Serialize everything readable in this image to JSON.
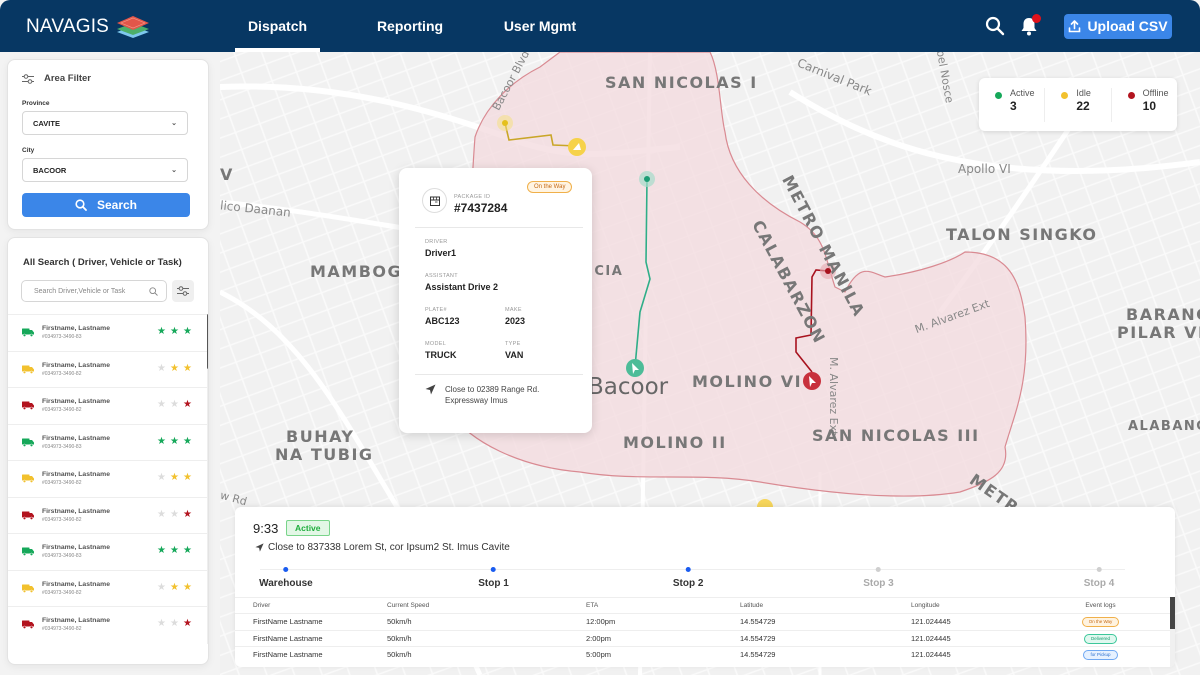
{
  "header": {
    "logo_text": "NAVAGIS",
    "tabs": [
      {
        "label": "Dispatch",
        "active": true
      },
      {
        "label": "Reporting",
        "active": false
      },
      {
        "label": "User Mgmt",
        "active": false
      }
    ],
    "upload_label": "Upload CSV",
    "icons": {
      "search": "search-icon",
      "bell": "bell-icon",
      "upload": "upload-icon"
    },
    "notification_dot": true
  },
  "area_filter": {
    "title": "Area Filter",
    "province_label": "Province",
    "province_value": "CAVITE",
    "city_label": "City",
    "city_value": "BACOOR",
    "search_label": "Search"
  },
  "all_search": {
    "title": "All Search ( Driver, Vehicle or Task)",
    "placeholder": "Search Driver,Vehicle or Task",
    "items": [
      {
        "name": "Firstname, Lastname",
        "id": "#034973-3490-83",
        "status": "active",
        "rating": 3
      },
      {
        "name": "Firstname, Lastname",
        "id": "#034973-3490-82",
        "status": "idle",
        "rating": 2
      },
      {
        "name": "Firstname, Lastname",
        "id": "#034973-3490-82",
        "status": "offline",
        "rating": 1
      },
      {
        "name": "Firstname, Lastname",
        "id": "#034973-3490-83",
        "status": "active",
        "rating": 3
      },
      {
        "name": "Firstname, Lastname",
        "id": "#034973-3490-82",
        "status": "idle",
        "rating": 2
      },
      {
        "name": "Firstname, Lastname",
        "id": "#034973-3490-82",
        "status": "offline",
        "rating": 1
      },
      {
        "name": "Firstname, Lastname",
        "id": "#034973-3490-83",
        "status": "active",
        "rating": 3
      },
      {
        "name": "Firstname, Lastname",
        "id": "#034973-3490-82",
        "status": "idle",
        "rating": 2
      },
      {
        "name": "Firstname, Lastname",
        "id": "#034973-3490-82",
        "status": "offline",
        "rating": 1
      }
    ]
  },
  "status_colors": {
    "active": "#16a85a",
    "idle": "#f2c12e",
    "offline": "#b3141f"
  },
  "legend": [
    {
      "label": "Active",
      "count": "3",
      "status": "active"
    },
    {
      "label": "Idle",
      "count": "22",
      "status": "idle"
    },
    {
      "label": "Offline",
      "count": "10",
      "status": "offline"
    }
  ],
  "package_card": {
    "package_label": "PACKAGE ID",
    "package_id": "#7437284",
    "status": "On the Way",
    "driver_label": "DRIVER",
    "driver": "Driver1",
    "assistant_label": "ASSISTANT",
    "assistant": "Assistant Drive 2",
    "plate_label": "PLATE#",
    "plate": "ABC123",
    "make_label": "MAKE",
    "make": "2023",
    "model_label": "MODEL",
    "model": "TRUCK",
    "type_label": "TYPE",
    "type": "VAN",
    "location_line1": "Close to 02389 Range Rd.",
    "location_line2": "Expressway Imus"
  },
  "map": {
    "labels": {
      "san_nicolas_i": "SAN NICOLAS I",
      "carnival_park": "Carnival Park",
      "bacoor_blvd": "Bacoor Blvd",
      "del_nosce": "bel Nosce",
      "metro_manila": "METRO MANILA",
      "calabarzon": "CALABARZON",
      "apollo": "Apollo VI",
      "talon_singko": "TALON SINGKO",
      "mambog": "MAMBOG",
      "ligas": "ICIA",
      "tanzang": "lico Daanan",
      "m_alvarez_ext": "M. Alvarez Ext",
      "m_alvarez_ext2": "M. Alvarez Ext",
      "barangay_pilar": "BARANGAY",
      "pilar_village": "PILAR VILLAGE",
      "bacoor": "Bacoor",
      "molino_vi": "MOLINO VI",
      "buhay_na_tubig_1": "BUHAY",
      "buhay_na_tubig_2": "NA TUBIG",
      "molino_ii": "MOLINO II",
      "san_nicolas_iii": "SAN NICOLAS III",
      "alabang": "ALABANG",
      "metro": "METRO",
      "v_label": "V",
      "rd": "w Rd"
    }
  },
  "trip": {
    "time": "9:33",
    "status": "Active",
    "location": "Close to 837338 Lorem St, cor Ipsum2 St. Imus Cavite",
    "stops": [
      {
        "label": "Warehouse",
        "done": true
      },
      {
        "label": "Stop 1",
        "done": true
      },
      {
        "label": "Stop 2",
        "done": true
      },
      {
        "label": "Stop 3",
        "done": false
      },
      {
        "label": "Stop 4",
        "done": false
      }
    ],
    "table": {
      "headers": [
        "Driver",
        "Current Speed",
        "ETA",
        "Latitude",
        "Longitude",
        "Event logs"
      ],
      "rows": [
        {
          "driver": "FirstName Lastname",
          "speed": "50km/h",
          "eta": "12:00pm",
          "lat": "14.554729",
          "lng": "121.024445",
          "event": "On the Way",
          "event_type": "onway"
        },
        {
          "driver": "FirstName Lastname",
          "speed": "50km/h",
          "eta": "2:00pm",
          "lat": "14.554729",
          "lng": "121.024445",
          "event": "Delivered",
          "event_type": "delivered"
        },
        {
          "driver": "FirstName Lastname",
          "speed": "50km/h",
          "eta": "5:00pm",
          "lat": "14.554729",
          "lng": "121.024445",
          "event": "for Pickup",
          "event_type": "pickup"
        }
      ]
    }
  }
}
